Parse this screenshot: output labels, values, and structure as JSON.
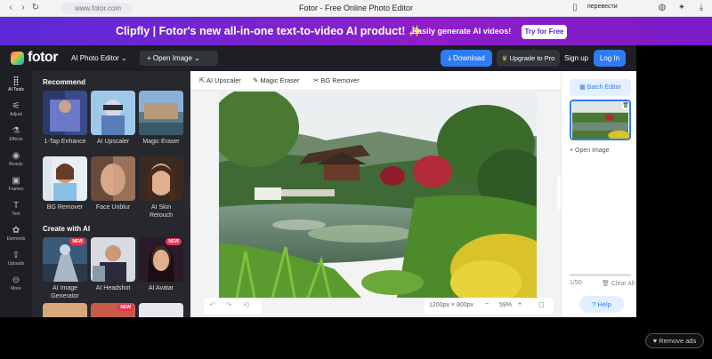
{
  "browser": {
    "url": "www.fotor.com",
    "title": "Fotor - Free Online Photo Editor",
    "extension_label": "перевести"
  },
  "promo": {
    "text": "Clipfly | Fotor's new all-in-one text-to-video AI product! ✨",
    "subtext": "Easily generate AI videos!",
    "button": "Try for Free"
  },
  "header": {
    "logo": "fotor",
    "editor_menu": "AI Photo Editor ⌄",
    "open_image": "+  Open Image  ⌄",
    "download": "Download",
    "upgrade": "Upgrade to Pro",
    "signup": "Sign up",
    "login": "Log In"
  },
  "rail": [
    {
      "label": "AI Tools",
      "icon": "grid-icon",
      "glyph": "⣿"
    },
    {
      "label": "Adjust",
      "icon": "sliders-icon",
      "glyph": "⚟"
    },
    {
      "label": "Effects",
      "icon": "flask-icon",
      "glyph": "⚗"
    },
    {
      "label": "Beauty",
      "icon": "eye-icon",
      "glyph": "◉"
    },
    {
      "label": "Frames",
      "icon": "frame-icon",
      "glyph": "▣"
    },
    {
      "label": "Text",
      "icon": "text-icon",
      "glyph": "T"
    },
    {
      "label": "Elements",
      "icon": "elements-icon",
      "glyph": "✿"
    },
    {
      "label": "Uploads",
      "icon": "upload-icon",
      "glyph": "⇪"
    },
    {
      "label": "More",
      "icon": "more-icon",
      "glyph": "⊝"
    }
  ],
  "panel": {
    "recommend_title": "Recommend",
    "recommend": [
      {
        "label": "1-Tap Enhance",
        "icon": "enhance-thumb-icon"
      },
      {
        "label": "AI Upscaler",
        "icon": "upscaler-thumb-icon"
      },
      {
        "label": "Magic Eraser",
        "icon": "eraser-thumb-icon"
      },
      {
        "label": "BG Remover",
        "icon": "bgremover-thumb-icon"
      },
      {
        "label": "Face Unblur",
        "icon": "unblur-thumb-icon"
      },
      {
        "label": "AI Skin Retouch",
        "icon": "retouch-thumb-icon"
      }
    ],
    "create_title": "Create with AI",
    "create": [
      {
        "label": "AI Image Generator",
        "badge": "NEW"
      },
      {
        "label": "AI Headshot",
        "badge": ""
      },
      {
        "label": "AI Avatar",
        "badge": "NEW"
      }
    ],
    "more_badge": "NEW"
  },
  "subtools": {
    "upscaler": "AI Upscaler",
    "eraser": "Magic Eraser",
    "bgremover": "BG Remover"
  },
  "canvas": {
    "size": "1200px × 800px",
    "zoom": "59%"
  },
  "right": {
    "batch": "Batch Editor",
    "open": "Open Image",
    "count": "1/50",
    "clear": "Clear All",
    "help": "Help"
  },
  "ads": {
    "remove": "Remove ads"
  },
  "colors": {
    "accent": "#2d7cf6",
    "dark": "#1e1f24",
    "promo": "#8b1fd1",
    "new_badge": "#e8344e"
  }
}
